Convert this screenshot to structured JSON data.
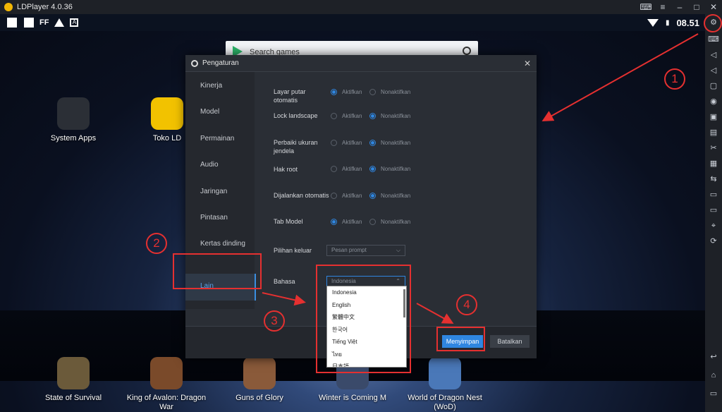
{
  "window": {
    "title": "LDPlayer 4.0.36",
    "controls": [
      "gamepad-icon",
      "menu-icon",
      "minimize-icon",
      "maximize-icon",
      "close-icon"
    ]
  },
  "status_bar": {
    "left_text": "FF",
    "box_text": "A",
    "time": "08.51"
  },
  "search": {
    "placeholder": "Search games"
  },
  "desktop_apps": [
    {
      "label": "System Apps"
    },
    {
      "label": "Toko LD"
    }
  ],
  "dock_apps": [
    {
      "label": "State of Survival"
    },
    {
      "label": "King of Avalon: Dragon War"
    },
    {
      "label": "Guns of Glory"
    },
    {
      "label": "Winter is Coming M"
    },
    {
      "label": "World of Dragon Nest (WoD)"
    }
  ],
  "dialog": {
    "title": "Pengaturan",
    "sidebar": [
      "Kinerja",
      "Model",
      "Permainan",
      "Audio",
      "Jaringan",
      "Pintasan",
      "Kertas dinding",
      "Lain"
    ],
    "active_item": "Lain",
    "options": {
      "on": "Aktifkan",
      "off": "Nonaktifkan"
    },
    "rows": [
      {
        "label": "Layar putar otomatis",
        "selected": "on"
      },
      {
        "label": "Lock landscape",
        "selected": "off"
      },
      {
        "label": "Perbaiki ukuran jendela",
        "selected": "off"
      },
      {
        "label": "Hak root",
        "selected": "off"
      },
      {
        "label": "Dijalankan otomatis",
        "selected": "off"
      },
      {
        "label": "Tab Model",
        "selected": "on"
      }
    ],
    "exit_choice": {
      "label": "Pilihan keluar",
      "value": "Pesan prompt"
    },
    "language": {
      "label": "Bahasa",
      "value": "Indonesia",
      "options": [
        "Indonesia",
        "English",
        "繁體中文",
        "한국어",
        "Tiếng Việt",
        "ไทย",
        "日本語"
      ]
    },
    "buttons": {
      "save": "Menyimpan",
      "cancel": "Batalkan"
    }
  },
  "annotations": [
    "1",
    "2",
    "3",
    "4"
  ],
  "colors": {
    "accent": "#2f86e0",
    "annotation": "#e53030",
    "dialog_bg": "#2a2e35"
  }
}
